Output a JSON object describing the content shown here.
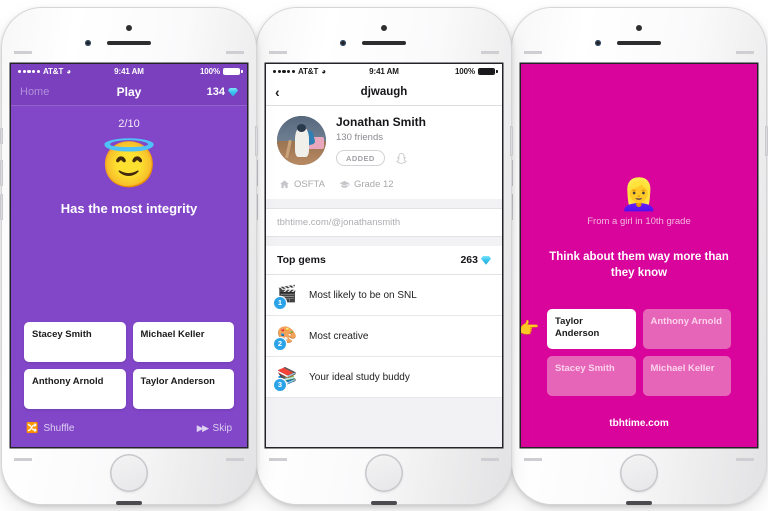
{
  "phones": {
    "phone1": {
      "status_bar": {
        "carrier": "AT&T",
        "wifi_icon": "wifi-icon",
        "time": "9:41 AM",
        "battery_text": "100%",
        "battery_icon": "battery-full-icon"
      },
      "nav": {
        "left_label": "Home",
        "title": "Play",
        "gem_count": "134",
        "gem_icon": "gem-icon"
      },
      "counter": "2/10",
      "emoji": "😇",
      "emoji_name": "smiling-face-with-halo",
      "prompt": "Has the most integrity",
      "answers": [
        "Stacey Smith",
        "Michael Keller",
        "Anthony Arnold",
        "Taylor Anderson"
      ],
      "footer": {
        "shuffle_label": "Shuffle",
        "shuffle_icon": "shuffle-icon",
        "skip_label": "Skip",
        "skip_icon": "fast-forward-icon"
      },
      "colors": {
        "background": "#8246c8",
        "nav_background": "#7b40bd",
        "card": "#ffffff"
      }
    },
    "phone2": {
      "status_bar": {
        "carrier": "AT&T",
        "wifi_icon": "wifi-icon",
        "time": "9:41 AM",
        "battery_text": "100%",
        "battery_icon": "battery-full-icon"
      },
      "nav": {
        "back_icon": "chevron-left-icon",
        "title": "djwaugh"
      },
      "profile": {
        "avatar_name": "profile-photo",
        "name": "Jonathan Smith",
        "friends": "130 friends",
        "added_label": "ADDED",
        "snapchat_icon": "snapchat-ghost-icon",
        "school": "OSFTA",
        "school_icon": "house-icon",
        "grade": "Grade 12",
        "grade_icon": "graduation-cap-icon"
      },
      "link": "tbhtime.com/@jonathansmith",
      "section": {
        "title": "Top gems",
        "count": "263",
        "gem_icon": "gem-icon"
      },
      "gems": [
        {
          "rank": "1",
          "emoji": "🎬",
          "emoji_name": "clapper-board",
          "label": "Most likely to be on SNL"
        },
        {
          "rank": "2",
          "emoji": "🎨",
          "emoji_name": "artist-palette",
          "label": "Most creative"
        },
        {
          "rank": "3",
          "emoji": "📚",
          "emoji_name": "books",
          "label": "Your ideal study buddy"
        }
      ],
      "colors": {
        "background": "#f2f2f4",
        "card": "#ffffff",
        "badge": "#2aa3e8"
      }
    },
    "phone3": {
      "emoji": "👱‍♀️",
      "emoji_name": "woman-blond-hair",
      "from": "From a girl in 10th grade",
      "headline": "Think about them way more than they know",
      "answers": [
        {
          "label": "Taylor Anderson",
          "picked": true
        },
        {
          "label": "Anthony Arnold",
          "picked": false
        },
        {
          "label": "Stacey Smith",
          "picked": false
        },
        {
          "label": "Michael Keller",
          "picked": false
        }
      ],
      "hand_icon": "pointing-right-hand",
      "url": "tbhtime.com",
      "colors": {
        "background": "#d9049c",
        "card": "#e765b8",
        "picked_card": "#ffffff"
      }
    }
  }
}
